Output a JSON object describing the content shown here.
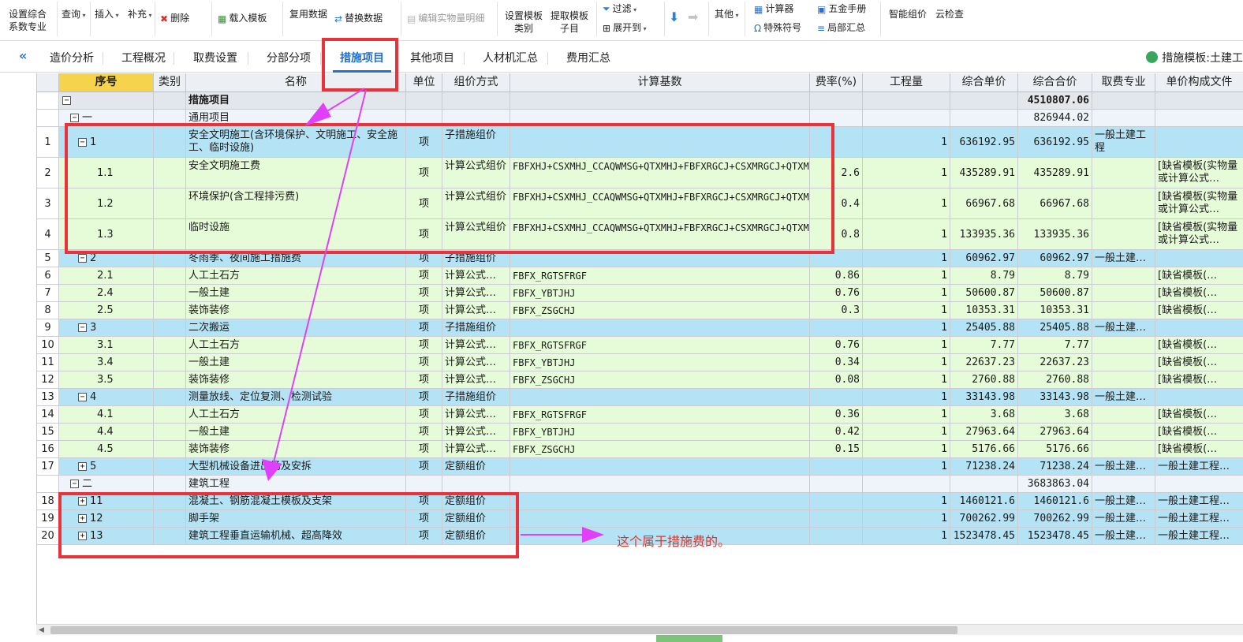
{
  "toolbar": {
    "items": [
      {
        "label": "设置综合\n系数专业",
        "icon": "settings-icon"
      },
      {
        "label": "查询",
        "icon": "search-icon"
      },
      {
        "label": "插入",
        "icon": "insert-icon"
      },
      {
        "label": "补充",
        "icon": "supplement-icon"
      },
      {
        "label": "删除",
        "icon": "delete-icon"
      },
      {
        "label": "载入模板",
        "icon": "load-template-icon"
      },
      {
        "label": "复用数据",
        "icon": "reuse-icon"
      },
      {
        "label": "替换数据",
        "icon": "replace-icon"
      },
      {
        "label": "编辑实物量明细",
        "icon": "edit-detail-icon",
        "disabled": true
      },
      {
        "label": "设置模板\n类别",
        "icon": "template-category-icon"
      },
      {
        "label": "提取模板\n子目",
        "icon": "extract-template-icon"
      },
      {
        "label": "过滤",
        "icon": "filter-icon"
      },
      {
        "label": "展开到",
        "icon": "expand-icon"
      },
      {
        "label": "其他",
        "icon": "more-icon"
      },
      {
        "label": "计算器",
        "icon": "calculator-icon"
      },
      {
        "label": "特殊符号",
        "icon": "omega-icon"
      },
      {
        "label": "五金手册",
        "icon": "manual-icon"
      },
      {
        "label": "局部汇总",
        "icon": "summary-icon"
      },
      {
        "label": "智能组价",
        "icon": "smart-pricing-icon"
      },
      {
        "label": "云检查",
        "icon": "cloud-check-icon"
      }
    ]
  },
  "tabs": [
    "造价分析",
    "工程概况",
    "取费设置",
    "分部分项",
    "措施项目",
    "其他项目",
    "人材机汇总",
    "费用汇总"
  ],
  "active_tab": "措施项目",
  "template_label": "措施模板:土建工",
  "columns": [
    "序号",
    "类别",
    "名称",
    "单位",
    "组价方式",
    "计算基数",
    "费率(%)",
    "工程量",
    "综合单价",
    "综合合价",
    "取费专业",
    "单价构成文件"
  ],
  "rows": [
    {
      "rownum": "",
      "seq": "",
      "toggle": "−",
      "indent": 0,
      "cat": "",
      "name": "措施项目",
      "unit": "",
      "method": "",
      "base": "",
      "rate": "",
      "qty": "",
      "price": "",
      "total": "4510807.06",
      "spec": "",
      "file": "",
      "type": "root"
    },
    {
      "rownum": "",
      "seq": "一",
      "toggle": "−",
      "indent": 1,
      "cat": "",
      "name": "通用项目",
      "unit": "",
      "method": "",
      "base": "",
      "rate": "",
      "qty": "",
      "price": "",
      "total": "826944.02",
      "spec": "",
      "file": "",
      "type": "group"
    },
    {
      "rownum": "1",
      "seq": "1",
      "toggle": "−",
      "indent": 2,
      "cat": "",
      "name": "安全文明施工(含环境保护、文明施工、安全施工、临时设施)",
      "unit": "项",
      "method": "子措施组价",
      "base": "",
      "rate": "",
      "qty": "1",
      "price": "636192.95",
      "total": "636192.95",
      "spec": "一般土建工程",
      "file": "",
      "type": "parent",
      "tall": true
    },
    {
      "rownum": "2",
      "seq": "1.1",
      "toggle": "",
      "indent": 3,
      "cat": "",
      "name": "安全文明施工费",
      "unit": "项",
      "method": "计算公式组价",
      "base": "FBFXHJ+CSXMHJ_CCAQWMSG+QTXMHJ+FBFXRGCJ+CSXMRGCJ+QTXMRGCJ",
      "rate": "2.6",
      "qty": "1",
      "price": "435289.91",
      "total": "435289.91",
      "spec": "",
      "file": "[缺省模板(实物量或计算公式…",
      "type": "child",
      "tall": true
    },
    {
      "rownum": "3",
      "seq": "1.2",
      "toggle": "",
      "indent": 3,
      "cat": "",
      "name": "环境保护(含工程排污费)",
      "unit": "项",
      "method": "计算公式组价",
      "base": "FBFXHJ+CSXMHJ_CCAQWMSG+QTXMHJ+FBFXRGCJ+CSXMRGCJ+QTXMRGCJ",
      "rate": "0.4",
      "qty": "1",
      "price": "66967.68",
      "total": "66967.68",
      "spec": "",
      "file": "[缺省模板(实物量或计算公式…",
      "type": "child",
      "tall": true
    },
    {
      "rownum": "4",
      "seq": "1.3",
      "toggle": "",
      "indent": 3,
      "cat": "",
      "name": "临时设施",
      "unit": "项",
      "method": "计算公式组价",
      "base": "FBFXHJ+CSXMHJ_CCAQWMSG+QTXMHJ+FBFXRGCJ+CSXMRGCJ+QTXMRGCJ",
      "rate": "0.8",
      "qty": "1",
      "price": "133935.36",
      "total": "133935.36",
      "spec": "",
      "file": "[缺省模板(实物量或计算公式…",
      "type": "child",
      "tall": true
    },
    {
      "rownum": "5",
      "seq": "2",
      "toggle": "−",
      "indent": 2,
      "cat": "",
      "name": "冬雨季、夜间施工措施费",
      "unit": "项",
      "method": "子措施组价",
      "base": "",
      "rate": "",
      "qty": "1",
      "price": "60962.97",
      "total": "60962.97",
      "spec": "一般土建…",
      "file": "",
      "type": "parent"
    },
    {
      "rownum": "6",
      "seq": "2.1",
      "toggle": "",
      "indent": 3,
      "cat": "",
      "name": "人工土石方",
      "unit": "项",
      "method": "计算公式…",
      "base": "FBFX_RGTSFRGF",
      "rate": "0.86",
      "qty": "1",
      "price": "8.79",
      "total": "8.79",
      "spec": "",
      "file": "[缺省模板(…",
      "type": "child"
    },
    {
      "rownum": "7",
      "seq": "2.4",
      "toggle": "",
      "indent": 3,
      "cat": "",
      "name": "一般土建",
      "unit": "项",
      "method": "计算公式…",
      "base": "FBFX_YBTJHJ",
      "rate": "0.76",
      "qty": "1",
      "price": "50600.87",
      "total": "50600.87",
      "spec": "",
      "file": "[缺省模板(…",
      "type": "child"
    },
    {
      "rownum": "8",
      "seq": "2.5",
      "toggle": "",
      "indent": 3,
      "cat": "",
      "name": "装饰装修",
      "unit": "项",
      "method": "计算公式…",
      "base": "FBFX_ZSGCHJ",
      "rate": "0.3",
      "qty": "1",
      "price": "10353.31",
      "total": "10353.31",
      "spec": "",
      "file": "[缺省模板(…",
      "type": "child"
    },
    {
      "rownum": "9",
      "seq": "3",
      "toggle": "−",
      "indent": 2,
      "cat": "",
      "name": "二次搬运",
      "unit": "项",
      "method": "子措施组价",
      "base": "",
      "rate": "",
      "qty": "1",
      "price": "25405.88",
      "total": "25405.88",
      "spec": "一般土建…",
      "file": "",
      "type": "parent"
    },
    {
      "rownum": "10",
      "seq": "3.1",
      "toggle": "",
      "indent": 3,
      "cat": "",
      "name": "人工土石方",
      "unit": "项",
      "method": "计算公式…",
      "base": "FBFX_RGTSFRGF",
      "rate": "0.76",
      "qty": "1",
      "price": "7.77",
      "total": "7.77",
      "spec": "",
      "file": "[缺省模板(…",
      "type": "child"
    },
    {
      "rownum": "11",
      "seq": "3.4",
      "toggle": "",
      "indent": 3,
      "cat": "",
      "name": "一般土建",
      "unit": "项",
      "method": "计算公式…",
      "base": "FBFX_YBTJHJ",
      "rate": "0.34",
      "qty": "1",
      "price": "22637.23",
      "total": "22637.23",
      "spec": "",
      "file": "[缺省模板(…",
      "type": "child"
    },
    {
      "rownum": "12",
      "seq": "3.5",
      "toggle": "",
      "indent": 3,
      "cat": "",
      "name": "装饰装修",
      "unit": "项",
      "method": "计算公式…",
      "base": "FBFX_ZSGCHJ",
      "rate": "0.08",
      "qty": "1",
      "price": "2760.88",
      "total": "2760.88",
      "spec": "",
      "file": "[缺省模板(…",
      "type": "child"
    },
    {
      "rownum": "13",
      "seq": "4",
      "toggle": "−",
      "indent": 2,
      "cat": "",
      "name": "测量放线、定位复测、检测试验",
      "unit": "项",
      "method": "子措施组价",
      "base": "",
      "rate": "",
      "qty": "1",
      "price": "33143.98",
      "total": "33143.98",
      "spec": "一般土建…",
      "file": "",
      "type": "parent"
    },
    {
      "rownum": "14",
      "seq": "4.1",
      "toggle": "",
      "indent": 3,
      "cat": "",
      "name": "人工土石方",
      "unit": "项",
      "method": "计算公式…",
      "base": "FBFX_RGTSFRGF",
      "rate": "0.36",
      "qty": "1",
      "price": "3.68",
      "total": "3.68",
      "spec": "",
      "file": "[缺省模板(…",
      "type": "child"
    },
    {
      "rownum": "15",
      "seq": "4.4",
      "toggle": "",
      "indent": 3,
      "cat": "",
      "name": "一般土建",
      "unit": "项",
      "method": "计算公式…",
      "base": "FBFX_YBTJHJ",
      "rate": "0.42",
      "qty": "1",
      "price": "27963.64",
      "total": "27963.64",
      "spec": "",
      "file": "[缺省模板(…",
      "type": "child"
    },
    {
      "rownum": "16",
      "seq": "4.5",
      "toggle": "",
      "indent": 3,
      "cat": "",
      "name": "装饰装修",
      "unit": "项",
      "method": "计算公式…",
      "base": "FBFX_ZSGCHJ",
      "rate": "0.15",
      "qty": "1",
      "price": "5176.66",
      "total": "5176.66",
      "spec": "",
      "file": "[缺省模板(…",
      "type": "child"
    },
    {
      "rownum": "17",
      "seq": "5",
      "toggle": "+",
      "indent": 2,
      "cat": "",
      "name": "大型机械设备进出场及安拆",
      "unit": "项",
      "method": "定额组价",
      "base": "",
      "rate": "",
      "qty": "1",
      "price": "71238.24",
      "total": "71238.24",
      "spec": "一般土建…",
      "file": "一般土建工程…",
      "type": "parent"
    },
    {
      "rownum": "",
      "seq": "二",
      "toggle": "−",
      "indent": 1,
      "cat": "",
      "name": "建筑工程",
      "unit": "",
      "method": "",
      "base": "",
      "rate": "",
      "qty": "",
      "price": "",
      "total": "3683863.04",
      "spec": "",
      "file": "",
      "type": "group"
    },
    {
      "rownum": "18",
      "seq": "11",
      "toggle": "+",
      "indent": 2,
      "cat": "",
      "name": "混凝土、钢筋混凝土模板及支架",
      "unit": "项",
      "method": "定额组价",
      "base": "",
      "rate": "",
      "qty": "1",
      "price": "1460121.6",
      "total": "1460121.6",
      "spec": "一般土建…",
      "file": "一般土建工程…",
      "type": "parent"
    },
    {
      "rownum": "19",
      "seq": "12",
      "toggle": "+",
      "indent": 2,
      "cat": "",
      "name": "脚手架",
      "unit": "项",
      "method": "定额组价",
      "base": "",
      "rate": "",
      "qty": "1",
      "price": "700262.99",
      "total": "700262.99",
      "spec": "一般土建…",
      "file": "一般土建工程…",
      "type": "parent"
    },
    {
      "rownum": "20",
      "seq": "13",
      "toggle": "+",
      "indent": 2,
      "cat": "",
      "name": "建筑工程垂直运输机械、超高降效",
      "unit": "项",
      "method": "定额组价",
      "base": "",
      "rate": "",
      "qty": "1",
      "price": "1523478.45",
      "total": "1523478.45",
      "spec": "一般土建…",
      "file": "一般土建工程…",
      "type": "parent"
    }
  ],
  "annotation": {
    "note": "这个属于措施费的。",
    "color": "#e0352b",
    "arrow_color": "#e040fb"
  },
  "colors": {
    "parent_row": "#b4e3f5",
    "child_row": "#e6fbd8",
    "group_row": "#eef4f9",
    "root_row": "#e3e6ea",
    "active_tab": "#1f6fd6",
    "highlight_box": "#e8333a"
  }
}
